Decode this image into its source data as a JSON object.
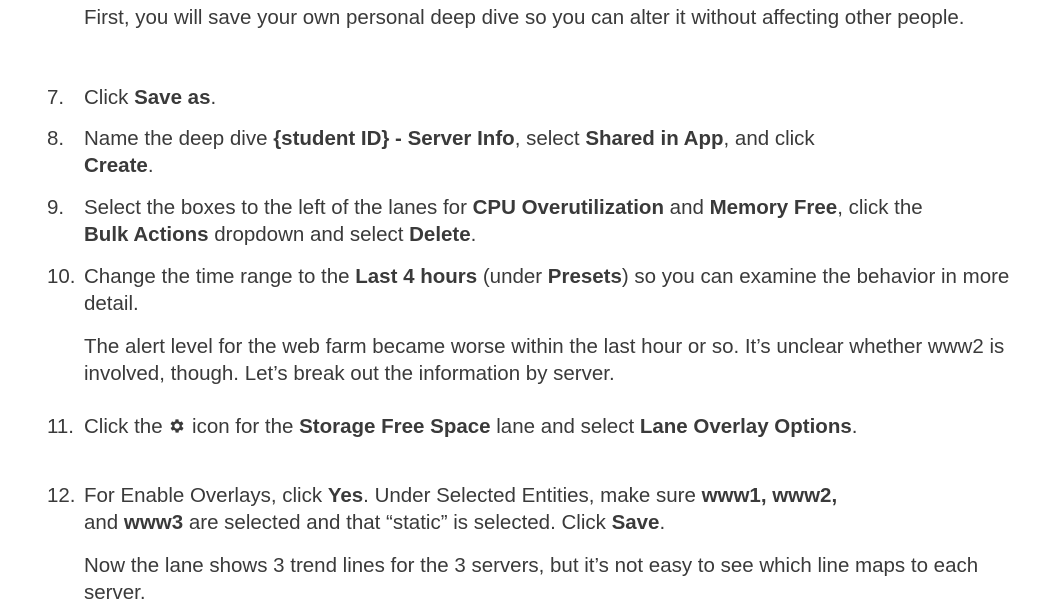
{
  "intro": "First, you will save your own personal deep dive so you can alter it without affecting other people.",
  "steps": [
    {
      "num": "7.",
      "t1": "Click ",
      "b1": "Save as",
      "t2": "."
    },
    {
      "num": "8.",
      "t1": "Name the deep dive ",
      "b1": "{student ID} - Server Info",
      "t2": ", select ",
      "b2": "Shared in App",
      "t3": ", and click ",
      "b3": "Create",
      "t4": "."
    },
    {
      "num": "9.",
      "t1": "Select the boxes to the left of the lanes for ",
      "b1": "CPU Overutilization",
      "t2": " and ",
      "b2": "Memory Free",
      "t3": ", click the ",
      "b3": "Bulk Actions",
      "t4": " dropdown and select ",
      "b4": "Delete",
      "t5": "."
    },
    {
      "num": "10.",
      "t1": "Change the time range to the ",
      "b1": "Last 4 hours",
      "t2": " (under ",
      "b2": "Presets",
      "t3": ") so you can examine the behavior in more detail."
    },
    {
      "num": "11.",
      "t1": "Click the ",
      "icon": "gear-icon",
      "t2": " icon for the ",
      "b1": "Storage Free Space",
      "t3": " lane and select ",
      "b2": "Lane Overlay Options",
      "t4": "."
    },
    {
      "num": "12.",
      "t1": "For Enable Overlays, click ",
      "b1": "Yes",
      "t2": ". Under Selected Entities, make sure ",
      "b2": "www1, www2,",
      "t3": " and ",
      "b3": "www3",
      "t4": " are selected and that “static” is selected. Click ",
      "b4": "Save",
      "t5": "."
    }
  ],
  "note1": "The alert level for the web farm became worse within the last hour or so. It’s unclear whether www2 is involved, though. Let’s break out the information by server.",
  "note2": "Now the lane shows 3 trend lines for the 3 servers, but it’s not easy to see which line maps to each server."
}
